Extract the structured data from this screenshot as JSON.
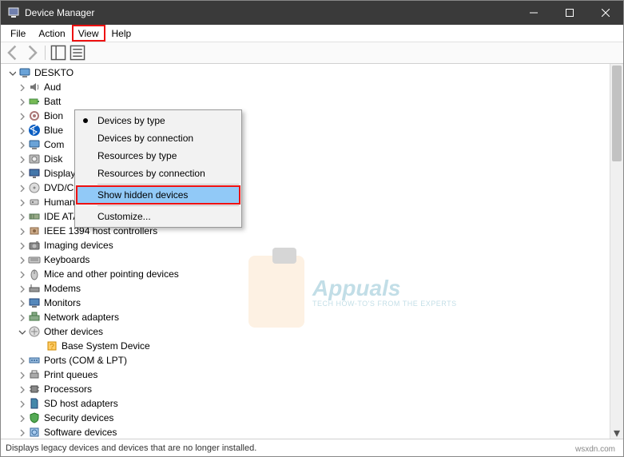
{
  "window": {
    "title": "Device Manager"
  },
  "menubar": {
    "items": [
      {
        "label": "File",
        "highlighted": false
      },
      {
        "label": "Action",
        "highlighted": false
      },
      {
        "label": "View",
        "highlighted": true
      },
      {
        "label": "Help",
        "highlighted": false
      }
    ]
  },
  "context_menu": {
    "items": [
      {
        "label": "Devices by type",
        "bullet": true,
        "selected": false,
        "highlight": false
      },
      {
        "label": "Devices by connection",
        "bullet": false,
        "selected": false,
        "highlight": false
      },
      {
        "label": "Resources by type",
        "bullet": false,
        "selected": false,
        "highlight": false
      },
      {
        "label": "Resources by connection",
        "bullet": false,
        "selected": false,
        "highlight": false
      },
      {
        "separator": true
      },
      {
        "label": "Show hidden devices",
        "bullet": false,
        "selected": true,
        "highlight": true
      },
      {
        "separator": true
      },
      {
        "label": "Customize...",
        "bullet": false,
        "selected": false,
        "highlight": false
      }
    ]
  },
  "tree": {
    "root": {
      "label": "DESKTO",
      "icon": "computer",
      "expanded": true
    },
    "categories": [
      {
        "label": "Aud",
        "full": "Audio inputs and outputs",
        "icon": "audio",
        "truncated": true
      },
      {
        "label": "Batt",
        "full": "Batteries",
        "icon": "battery",
        "truncated": true
      },
      {
        "label": "Bion",
        "full": "Biometric devices",
        "icon": "biometric",
        "truncated": true
      },
      {
        "label": "Blue",
        "full": "Bluetooth",
        "icon": "bluetooth",
        "truncated": true
      },
      {
        "label": "Com",
        "full": "Computer",
        "icon": "computer",
        "truncated": true
      },
      {
        "label": "Disk",
        "full": "Disk drives",
        "icon": "disk",
        "truncated": true
      },
      {
        "label": "Display adapters",
        "icon": "display",
        "truncated": false
      },
      {
        "label": "DVD/CD-ROM drives",
        "icon": "dvd",
        "truncated": false
      },
      {
        "label": "Human Interface Devices",
        "icon": "hid",
        "truncated": false
      },
      {
        "label": "IDE ATA/ATAPI controllers",
        "icon": "ide",
        "truncated": false
      },
      {
        "label": "IEEE 1394 host controllers",
        "icon": "ieee",
        "truncated": false
      },
      {
        "label": "Imaging devices",
        "icon": "imaging",
        "truncated": false
      },
      {
        "label": "Keyboards",
        "icon": "keyboard",
        "truncated": false
      },
      {
        "label": "Mice and other pointing devices",
        "icon": "mouse",
        "truncated": false
      },
      {
        "label": "Modems",
        "icon": "modem",
        "truncated": false
      },
      {
        "label": "Monitors",
        "icon": "monitor",
        "truncated": false
      },
      {
        "label": "Network adapters",
        "icon": "network",
        "truncated": false
      },
      {
        "label": "Other devices",
        "icon": "other",
        "expanded": true,
        "children": [
          {
            "label": "Base System Device",
            "icon": "unknown"
          }
        ]
      },
      {
        "label": "Ports (COM & LPT)",
        "icon": "ports",
        "truncated": false
      },
      {
        "label": "Print queues",
        "icon": "printer",
        "truncated": false
      },
      {
        "label": "Processors",
        "icon": "cpu",
        "truncated": false
      },
      {
        "label": "SD host adapters",
        "icon": "sd",
        "truncated": false
      },
      {
        "label": "Security devices",
        "icon": "security",
        "truncated": false
      },
      {
        "label": "Software devices",
        "icon": "software",
        "truncated": false
      }
    ]
  },
  "statusbar": {
    "text": "Displays legacy devices and devices that are no longer installed."
  },
  "watermark": {
    "brand": "Appuals",
    "tagline": "TECH HOW-TO'S FROM THE EXPERTS"
  },
  "attribution": "wsxdn.com"
}
